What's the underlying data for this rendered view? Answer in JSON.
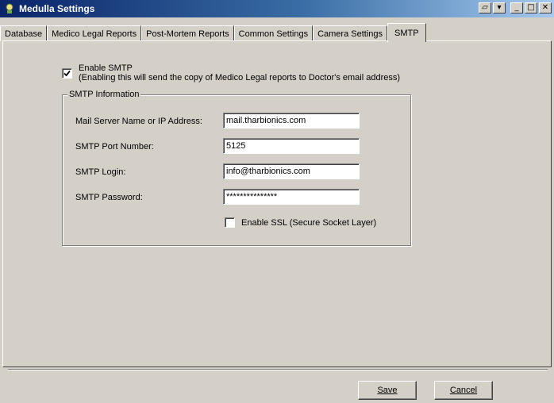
{
  "window": {
    "title": "Medulla Settings",
    "app_icon": "medulla-app-icon",
    "controls": {
      "restore": "▱",
      "dropdown": "▾",
      "minimize": "_",
      "maximize": "□",
      "close": "✕"
    }
  },
  "tabs": [
    {
      "label": "Database"
    },
    {
      "label": "Medico Legal Reports"
    },
    {
      "label": "Post-Mortem Reports"
    },
    {
      "label": "Common Settings"
    },
    {
      "label": "Camera Settings"
    },
    {
      "label": "SMTP"
    }
  ],
  "active_tab": "SMTP",
  "smtp": {
    "enable_label": "Enable SMTP",
    "enable_hint": "(Enabling this will send the copy of Medico Legal reports to Doctor's  email address)",
    "enable_checked": true,
    "group_title": "SMTP Information",
    "mail_server_label": "Mail Server Name or IP Address:",
    "mail_server_value": "mail.tharbionics.com",
    "port_label": "SMTP Port Number:",
    "port_value": "5125",
    "login_label": "SMTP Login:",
    "login_value": "info@tharbionics.com",
    "password_label": "SMTP Password:",
    "password_value": "***************",
    "ssl_label": "Enable SSL (Secure Socket Layer)",
    "ssl_checked": false
  },
  "buttons": {
    "save": "Save",
    "cancel": "Cancel"
  },
  "colors": {
    "face": "#d4d0c8",
    "title_start": "#0a246a",
    "title_end": "#a6caf0"
  }
}
